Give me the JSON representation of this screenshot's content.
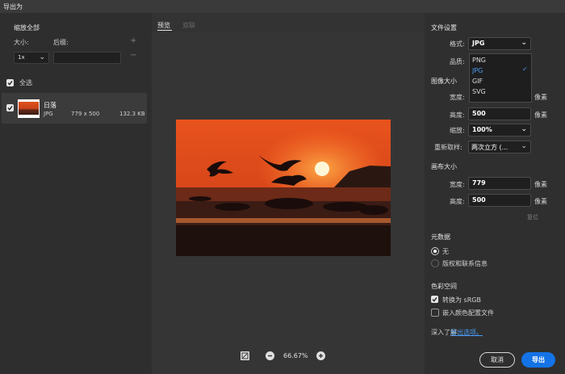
{
  "window": {
    "title": "导出为"
  },
  "left": {
    "section_title": "缩放全部",
    "size_label": "大小:",
    "suffix_label": "后缀:",
    "scale_value": "1x",
    "add_symbol": "+",
    "remove_symbol": "−",
    "select_all_label": "全选",
    "asset": {
      "name": "日落",
      "format": "JPG",
      "dimensions": "779 x 500",
      "filesize": "132.3 KB"
    }
  },
  "center": {
    "tabs": [
      {
        "label": "预览"
      },
      {
        "label": "双联"
      }
    ],
    "zoom_value": "66.67%"
  },
  "right": {
    "file_settings": {
      "title": "文件设置",
      "format_label": "格式:",
      "format_value": "JPG",
      "quality_label": "品质:",
      "format_options": [
        "PNG",
        "JPG",
        "GIF",
        "SVG"
      ]
    },
    "image_size": {
      "title": "图像大小",
      "width_label": "宽度:",
      "height_label": "高度:",
      "height_value": "500",
      "unit": "像素",
      "scale_label": "缩放:",
      "scale_value": "100%",
      "resample_label": "重新取样:",
      "resample_value": "两次立方 (..."
    },
    "canvas_size": {
      "title": "画布大小",
      "width_label": "宽度:",
      "width_value": "779",
      "height_label": "高度:",
      "height_value": "500",
      "unit": "像素",
      "reset_label": "复位"
    },
    "metadata": {
      "title": "元数据",
      "options": [
        "无",
        "版权和联系信息"
      ]
    },
    "color_space": {
      "title": "色彩空间",
      "convert_label": "转换为 sRGB",
      "embed_label": "嵌入颜色配置文件"
    },
    "learn_more_label": "深入了解",
    "learn_more_link": "导出选项。"
  },
  "buttons": {
    "cancel": "取消",
    "export": "导出"
  },
  "colors": {
    "accent": "#1473e6",
    "checkbox": "#e6e6e6"
  }
}
